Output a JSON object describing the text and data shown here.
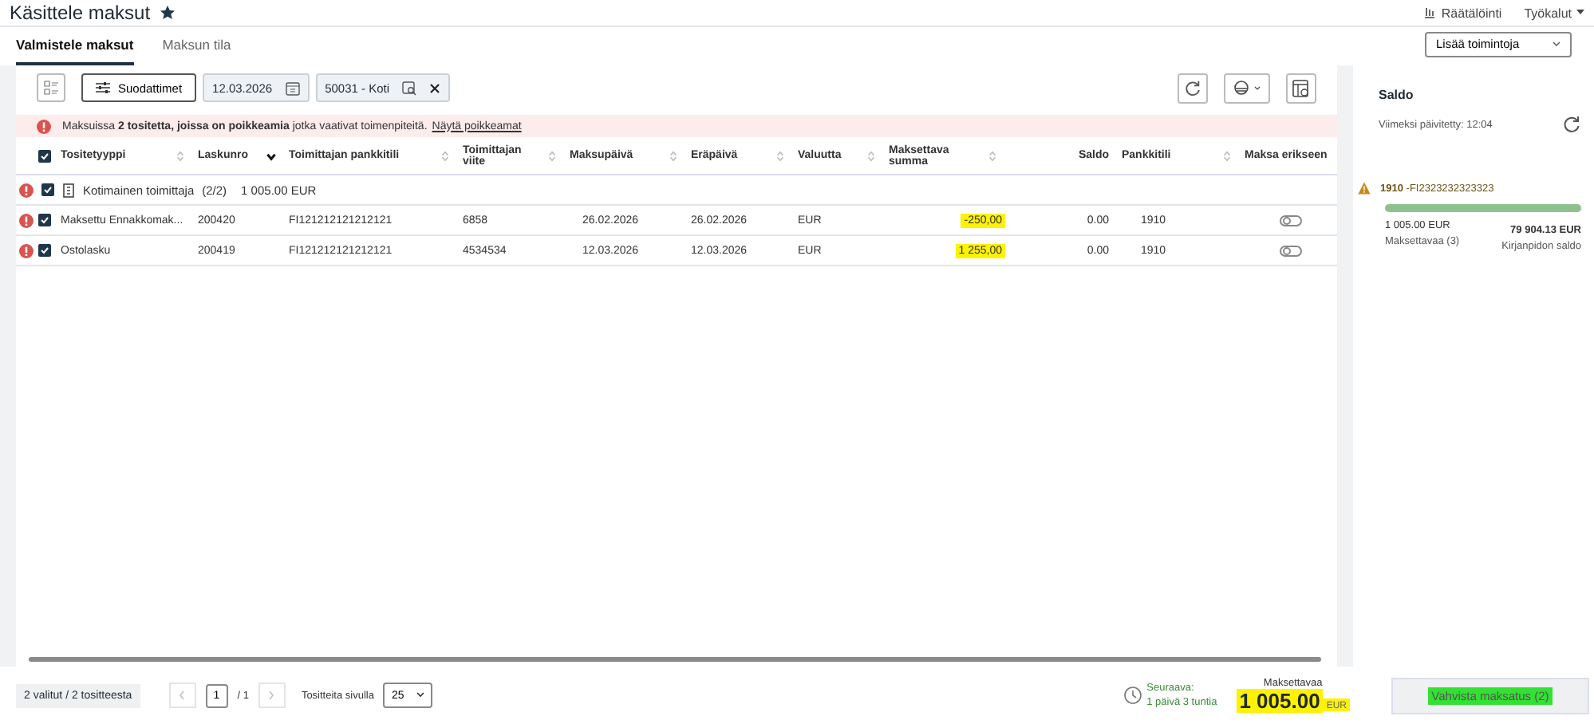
{
  "page": {
    "title": "Käsittele maksut",
    "favorite": true,
    "links": [
      {
        "label": "Räätälöinti",
        "kind": "customize"
      },
      {
        "label": "Työkalut",
        "kind": "menu"
      }
    ]
  },
  "tabs": [
    {
      "label": "Valmistele maksut",
      "selected": true
    },
    {
      "label": "Maksun tila",
      "selected": false
    }
  ],
  "actions_dropdown": {
    "label": "Lisää toimintoja"
  },
  "toolbar": {
    "filters_button": "Suodattimet",
    "date": "12.03.2026",
    "account": "50031 - Koti"
  },
  "alert": {
    "text": "Maksuissa **2 tositetta, joissa on poikkeamia** jotka vaativat toimenpiteitä.",
    "link": "Näytä poikkeamat"
  },
  "table": {
    "all_checked": true,
    "columns": [
      {
        "label": "Tositetyyppi",
        "sortable": true,
        "sorted": false
      },
      {
        "label": "Laskunro",
        "sortable": true,
        "sorted": true
      },
      {
        "label": "Toimittajan pankkitili",
        "sortable": true,
        "sorted": false
      },
      {
        "label": "Toimittajan viite",
        "sortable": true,
        "sorted": false
      },
      {
        "label": "Maksupäivä",
        "sortable": true,
        "sorted": false
      },
      {
        "label": "Eräpäivä",
        "sortable": true,
        "sorted": false
      },
      {
        "label": "Valuutta",
        "sortable": true,
        "sorted": false
      },
      {
        "label": "Maksettava summa",
        "sortable": true,
        "sorted": false
      },
      {
        "label": "Saldo",
        "sortable": false
      },
      {
        "label": "Pankkitili",
        "sortable": true,
        "sorted": false
      },
      {
        "label": "Maksa erikseen",
        "sortable": false
      }
    ],
    "group": {
      "name": "Kotimainen toimittaja",
      "count": "(2/2)",
      "total": "1 005.00 EUR",
      "checked": true,
      "warning": true
    },
    "rows": [
      {
        "warning": true,
        "checked": true,
        "cells": [
          "Maksettu Ennakkomak...",
          "200420",
          "FI121212121212121",
          "6858",
          "26.02.2026",
          "26.02.2026",
          "EUR",
          "-250,00",
          "0.00",
          "1910"
        ],
        "highlighted": true,
        "pay_separately": false
      },
      {
        "warning": true,
        "checked": true,
        "cells": [
          "Ostolasku",
          "200419",
          "FI121212121212121",
          "4534534",
          "12.03.2026",
          "12.03.2026",
          "EUR",
          "1 255,00",
          "0.00",
          "1910"
        ],
        "highlighted": true,
        "pay_separately": false
      }
    ]
  },
  "saldo": {
    "title": "Saldo",
    "updated": "Viimeksi päivitetty: 12:04",
    "account": {
      "number": "1910",
      "iban": "-FI2323232323323",
      "warning": true,
      "level": 1,
      "to_pay": "1 005.00 EUR",
      "to_pay_label": "Maksettavaa (3)",
      "balance": "79 904.13 EUR",
      "balance_label": "Kirjanpidon saldo"
    }
  },
  "footer": {
    "selection": "2 valitut / 2 tositteesta",
    "page": "1",
    "pages": "/ 1",
    "per_page_label": "Tositteita sivulla",
    "per_page": "25",
    "next_label": "Seuraava:",
    "next_time": "1 päivä 3 tuntia",
    "to_pay_label": "Maksettavaa",
    "to_pay_amount": "1 005.00",
    "to_pay_currency": "EUR",
    "amount_highlighted": true,
    "confirm": "Vahvista maksatus (2)",
    "confirm_highlighted": true
  }
}
